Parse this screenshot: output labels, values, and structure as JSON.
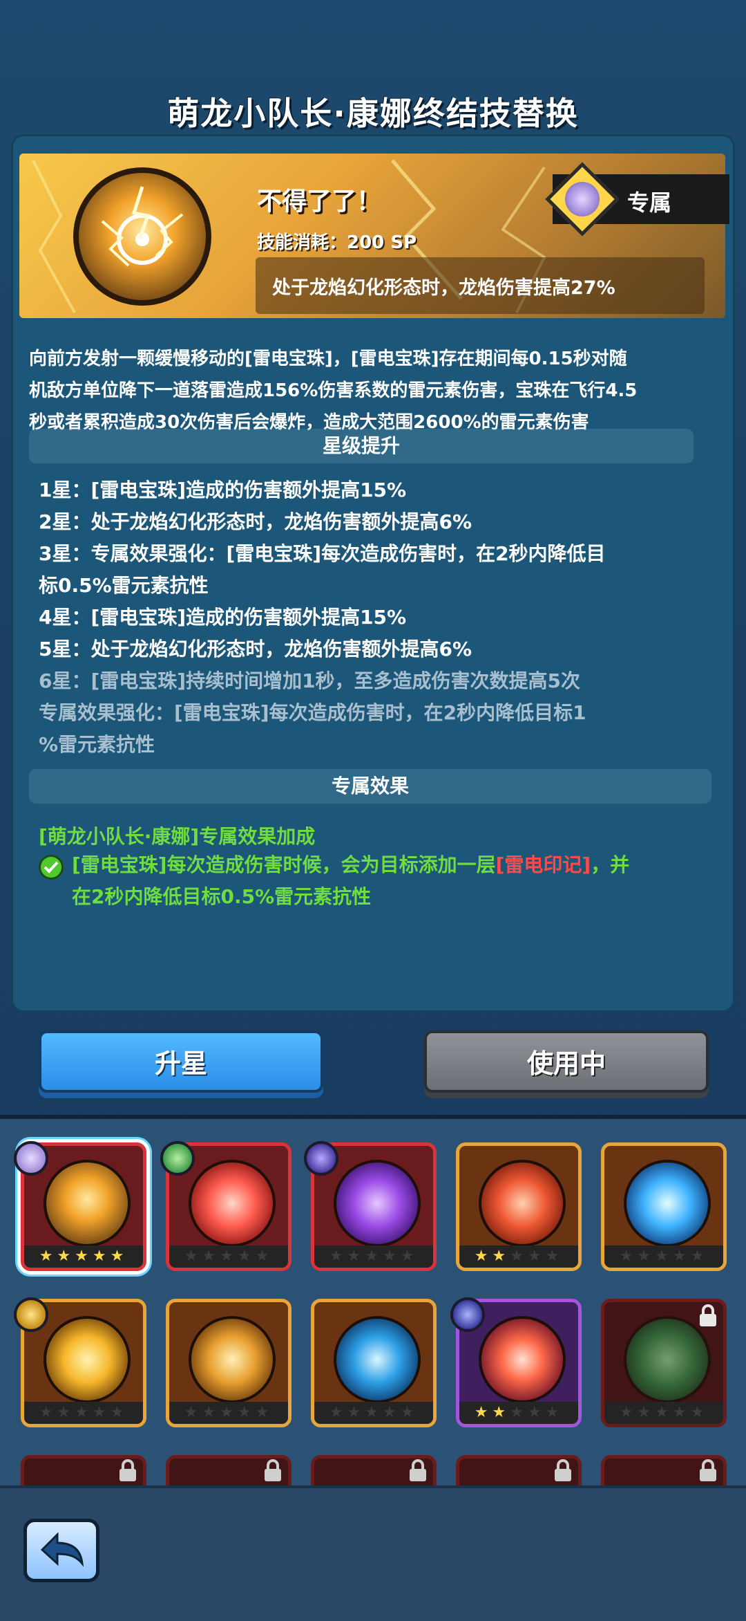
{
  "header": {
    "title": "萌龙小队长·康娜终结技替换"
  },
  "skill": {
    "name": "不得了了！",
    "cost": "技能消耗：200 SP",
    "effect": "处于龙焰幻化形态时，龙焰伤害提高27%",
    "exclusive_label": "专属",
    "description": [
      "向前方发射一颗缓慢移动的[雷电宝珠]，[雷电宝珠]存在期间每0.15秒对随",
      "机敌方单位降下一道落雷造成156%伤害系数的雷元素伤害，宝珠在飞行4.5",
      "秒或者累积造成30次伤害后会爆炸，造成大范围2600%的雷元素伤害"
    ]
  },
  "star_section": {
    "title": "星级提升",
    "lines": [
      {
        "text": "1星：[雷电宝珠]造成的伤害额外提高15%",
        "active": true
      },
      {
        "text": "2星：处于龙焰幻化形态时，龙焰伤害额外提高6%",
        "active": true
      },
      {
        "text": "3星：专属效果强化：[雷电宝珠]每次造成伤害时，在2秒内降低目",
        "active": true
      },
      {
        "text": "标0.5%雷元素抗性",
        "active": true
      },
      {
        "text": "4星：[雷电宝珠]造成的伤害额外提高15%",
        "active": true
      },
      {
        "text": "5星：处于龙焰幻化形态时，龙焰伤害额外提高6%",
        "active": true
      },
      {
        "text": "6星：[雷电宝珠]持续时间增加1秒，至多造成伤害次数提高5次",
        "active": false
      },
      {
        "text": "专属效果强化：[雷电宝珠]每次造成伤害时，在2秒内降低目标1",
        "active": false
      },
      {
        "text": "%雷元素抗性",
        "active": false
      }
    ]
  },
  "exclusive_section": {
    "title": "专属效果",
    "bonus_title": "[萌龙小队长·康娜]专属效果加成",
    "line1_prefix": "[雷电宝珠]每次造成伤害时候，会为目标添加一层",
    "line1_highlight": "[雷电印记]",
    "line1_suffix": "，并",
    "line2": "在2秒内降低目标0.5%雷元素抗性"
  },
  "buttons": {
    "upgrade": "升星",
    "in_use": "使用中"
  },
  "colors": {
    "accent_blue": "#2b8ee8",
    "green": "#6fdc3f",
    "red": "#ff4a4a",
    "gold": "#ffd84a"
  },
  "skill_cards": [
    {
      "name": "thunder-orb-skill",
      "rarity": "red",
      "stars": 5,
      "selected": true,
      "badge": "kanna"
    },
    {
      "name": "mushroom-explosion-skill",
      "rarity": "red",
      "stars": 0,
      "badge": "green-dragon"
    },
    {
      "name": "dark-spike-skill",
      "rarity": "red",
      "stars": 0,
      "badge": "purple-dragon"
    },
    {
      "name": "meteor-skill",
      "rarity": "gold",
      "stars": 2
    },
    {
      "name": "ice-shard-skill",
      "rarity": "gold",
      "stars": 0
    },
    {
      "name": "lightning-strike-skill",
      "rarity": "gold",
      "stars": 0,
      "badge": "yellow-dragon"
    },
    {
      "name": "thunder-bolts-skill",
      "rarity": "gold",
      "stars": 0
    },
    {
      "name": "ice-spikes-skill",
      "rarity": "gold",
      "stars": 0
    },
    {
      "name": "fire-orb-skill",
      "rarity": "purple",
      "stars": 2,
      "badge": "violet-dragon"
    },
    {
      "name": "poison-skill",
      "rarity": "locked",
      "stars": 0
    }
  ]
}
